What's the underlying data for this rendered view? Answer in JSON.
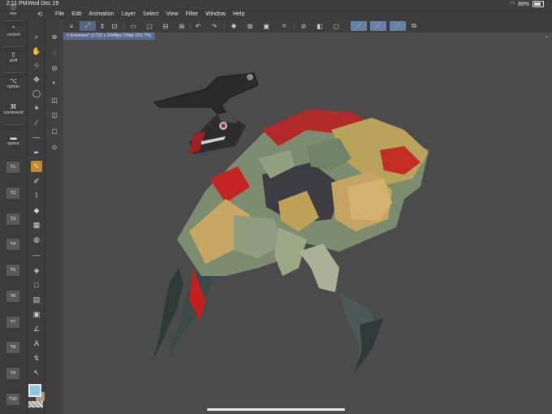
{
  "status": {
    "time": "2:11 PM",
    "date": "Wed Dec 29",
    "battery": "88%"
  },
  "menu": {
    "items": [
      "File",
      "Edit",
      "Animation",
      "Layer",
      "Select",
      "View",
      "Filter",
      "Window",
      "Help"
    ]
  },
  "modifiers": {
    "esc": "esc",
    "control": "control",
    "shift": "shift",
    "option": "option",
    "command": "command",
    "space": "space",
    "tkeys": [
      "T1",
      "T2",
      "T3",
      "T4",
      "T5",
      "T6",
      "T7",
      "T8",
      "T9",
      "T10"
    ]
  },
  "document": {
    "tab_label": "Enemies* (2732 x 2048px 72dpi 153.7%)"
  },
  "colors": {
    "main_color": "#8ec7e6",
    "sub_color": "#b79474",
    "active_tool": "#c58a2e",
    "accent": "#6a7fa8"
  },
  "icons": {
    "toolbar": [
      "menu-icon",
      "transform-icon",
      "adjust-icon",
      "record-icon",
      "new-icon",
      "open-icon",
      "save-icon",
      "export-icon",
      "undo-icon",
      "redo-icon",
      "wand-icon",
      "clear-icon",
      "crop-icon",
      "select-all-icon",
      "deselect-icon",
      "invert-icon",
      "pen-1-icon",
      "pen-2-icon",
      "pen-3-icon",
      "layer-icon"
    ]
  }
}
